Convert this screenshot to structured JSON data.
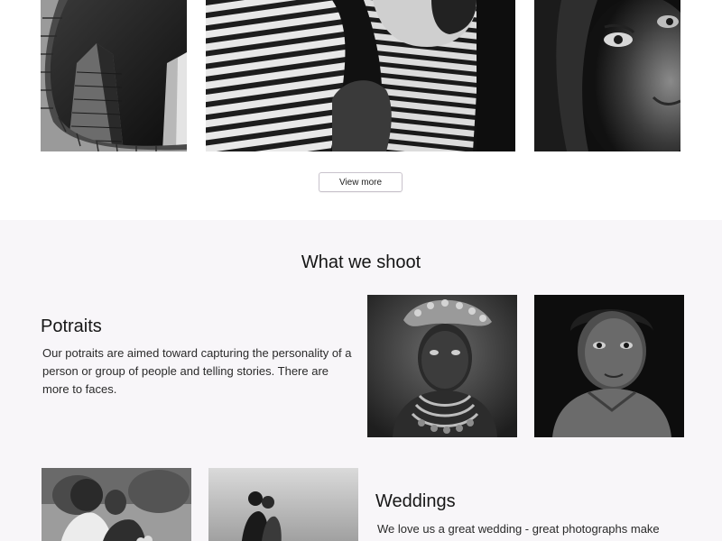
{
  "gallery": {
    "photos": [
      {
        "name": "architecture-photo",
        "alt": "Skyscrapers"
      },
      {
        "name": "striped-shadow-photo",
        "alt": "Striped shadows"
      },
      {
        "name": "woman-portrait-photo",
        "alt": "Woman portrait"
      }
    ],
    "view_more_label": "View more"
  },
  "what_we_shoot": {
    "title": "What we shoot",
    "categories": [
      {
        "heading": "Potraits",
        "text": "Our potraits are aimed toward capturing the personality of a person or group of people and telling stories. There are more to faces."
      },
      {
        "heading": "Weddings",
        "text": "We love us a great wedding - great photographs make"
      }
    ]
  },
  "colors": {
    "section_background": "#f8f6f9",
    "button_border": "#c9c3cc",
    "text": "#111111"
  }
}
